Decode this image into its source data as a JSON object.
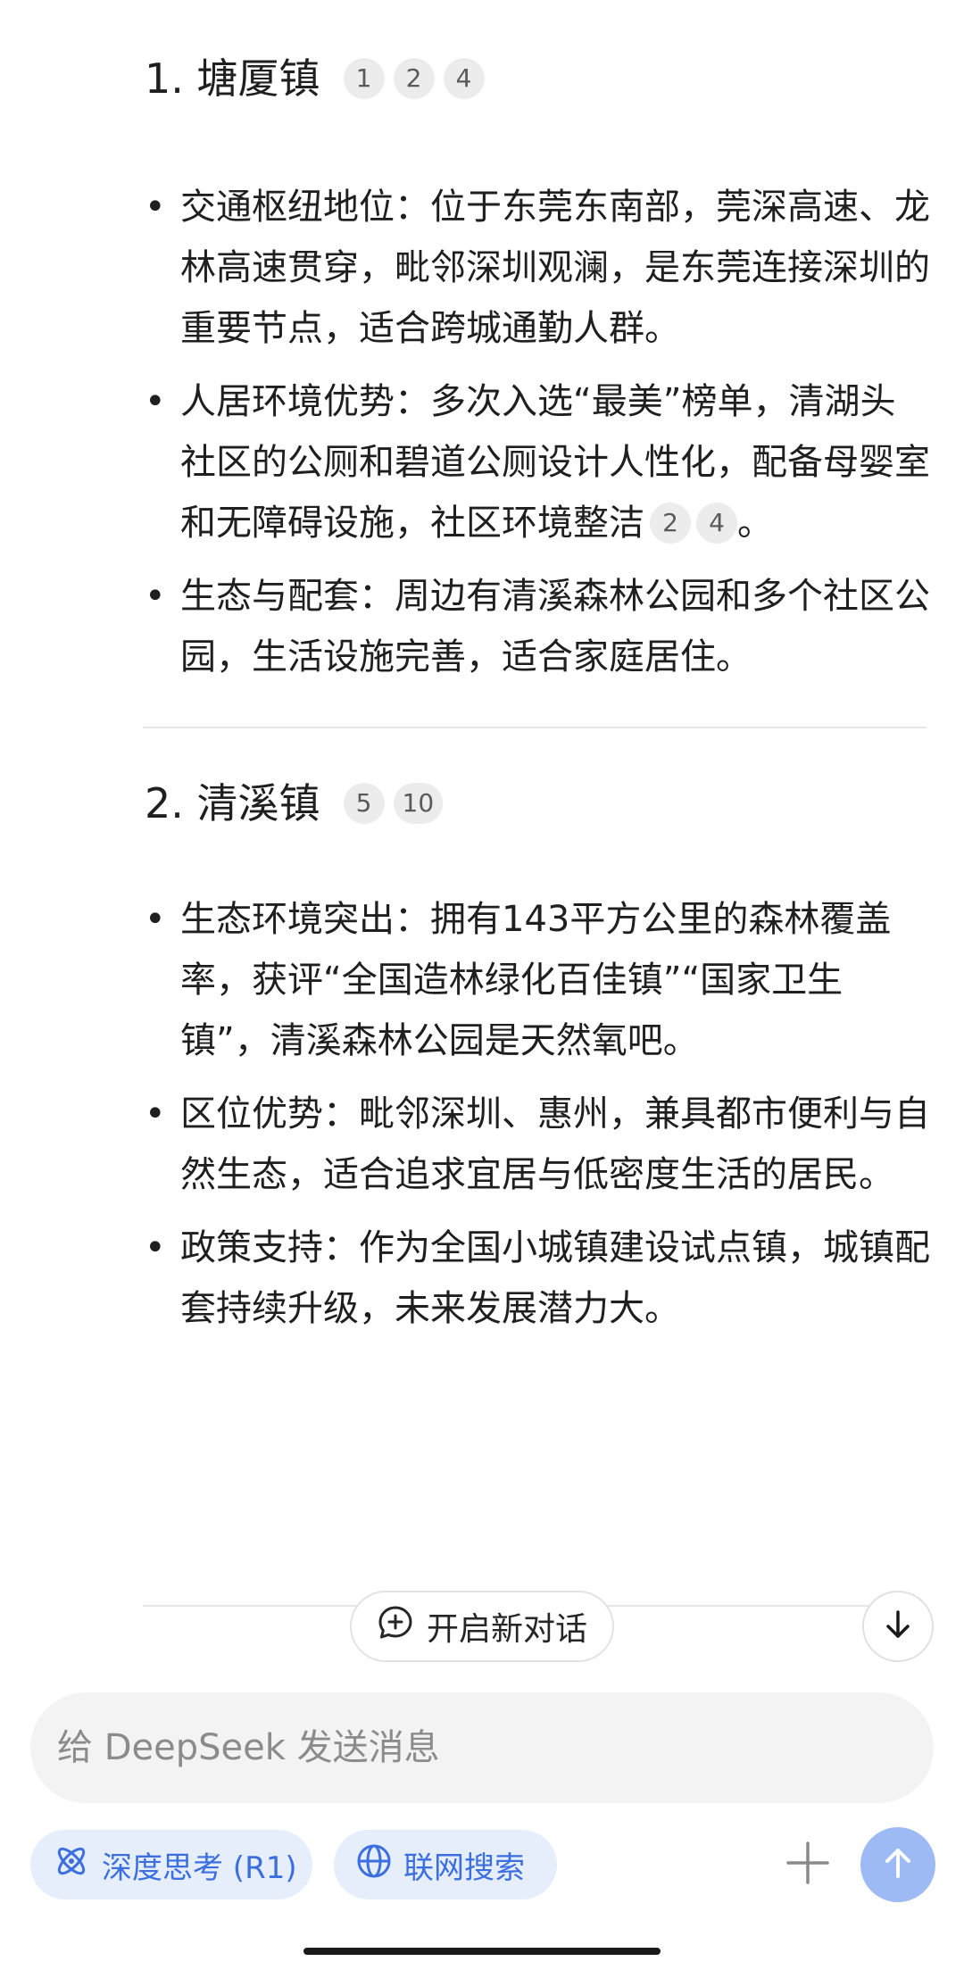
{
  "sections": [
    {
      "heading": "1. 塘厦镇",
      "refs": [
        "1",
        "2",
        "4"
      ],
      "bullets": [
        {
          "text": "交通枢纽地位：位于东莞东南部，莞深高速、龙林高速贯穿，毗邻深圳观澜，是东莞连接深圳的重要节点，适合跨城通勤人群。",
          "refs": [],
          "tail": ""
        },
        {
          "text": "人居环境优势：多次入选“最美”榜单，清湖头社区的公厕和碧道公厕设计人性化，配备母婴室和无障碍设施，社区环境整洁",
          "refs": [
            "2",
            "4"
          ],
          "tail": "。"
        },
        {
          "text": "生态与配套：周边有清溪森林公园和多个社区公园，生活设施完善，适合家庭居住。",
          "refs": [],
          "tail": ""
        }
      ]
    },
    {
      "heading": "2. 清溪镇",
      "refs": [
        "5",
        "10"
      ],
      "bullets": [
        {
          "text": "生态环境突出：拥有143平方公里的森林覆盖率，获评“全国造林绿化百佳镇”“国家卫生镇”，清溪森林公园是天然氧吧。",
          "refs": [],
          "tail": ""
        },
        {
          "text": "区位优势：毗邻深圳、惠州，兼具都市便利与自然生态，适合追求宜居与低密度生活的居民。",
          "refs": [],
          "tail": ""
        },
        {
          "text": "政策支持：作为全国小城镇建设试点镇，城镇配套持续升级，未来发展潜力大。",
          "refs": [],
          "tail": ""
        }
      ]
    }
  ],
  "new_chat_label": "开启新对话",
  "input": {
    "placeholder": "给 DeepSeek 发送消息",
    "value": ""
  },
  "deep_think_label": "深度思考 (R1)",
  "web_search_label": "联网搜索",
  "icons": {
    "new_chat": "chat-plus-icon",
    "scroll_down": "arrow-down-icon",
    "deep_think": "atom-icon",
    "web_search": "globe-icon",
    "attach": "plus-icon",
    "send": "arrow-up-icon"
  },
  "colors": {
    "accent": "#3b6fe0",
    "pill_bg": "#e6eefc",
    "send_bg": "#9dbaf5",
    "input_bg": "#f3f3f3",
    "badge_bg": "#ececec"
  }
}
